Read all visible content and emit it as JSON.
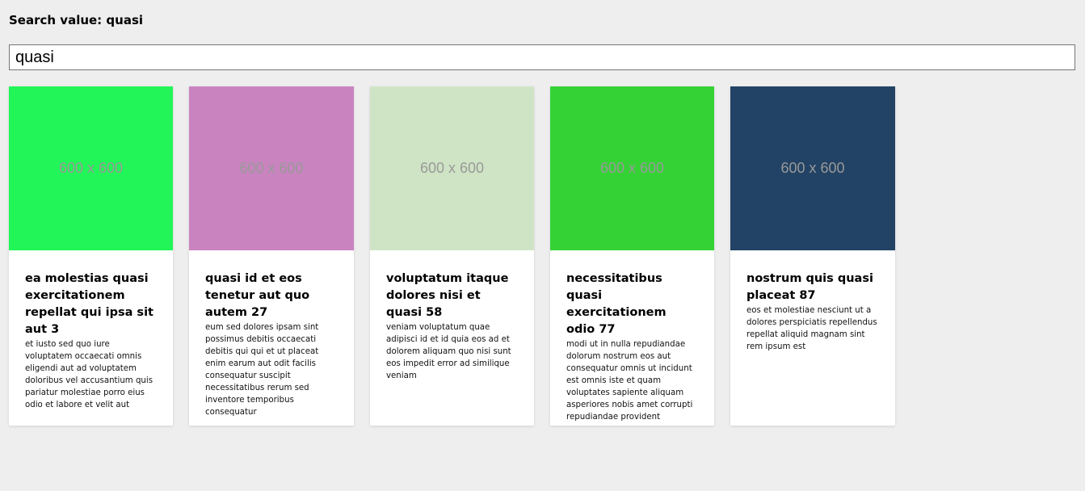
{
  "search": {
    "label": "Search value: quasi",
    "value": "quasi"
  },
  "cards": [
    {
      "color": "#22f557",
      "image_label": "600 x 600",
      "title": "ea molestias quasi exercitationem repellat qui ipsa sit aut 3",
      "text": "et iusto sed quo iure voluptatem occaecati omnis eligendi aut ad voluptatem doloribus vel accusantium quis pariatur molestiae porro eius odio et labore et velit aut"
    },
    {
      "color": "#c984c0",
      "image_label": "600 x 600",
      "title": "quasi id et eos tenetur aut quo autem 27",
      "text": "eum sed dolores ipsam sint possimus debitis occaecati debitis qui qui et ut placeat enim earum aut odit facilis consequatur suscipit necessitatibus rerum sed inventore temporibus consequatur"
    },
    {
      "color": "#cfe4c4",
      "image_label": "600 x 600",
      "title": "voluptatum itaque dolores nisi et quasi 58",
      "text": "veniam voluptatum quae adipisci id et id quia eos ad et dolorem aliquam quo nisi sunt eos impedit error ad similique veniam"
    },
    {
      "color": "#35d236",
      "image_label": "600 x 600",
      "title": "necessitatibus quasi exercitationem odio 77",
      "text": "modi ut in nulla repudiandae dolorum nostrum eos aut consequatur omnis ut incidunt est omnis iste et quam voluptates sapiente aliquam asperiores nobis amet corrupti repudiandae provident"
    },
    {
      "color": "#224365",
      "image_label": "600 x 600",
      "title": "nostrum quis quasi placeat 87",
      "text": "eos et molestiae nesciunt ut a dolores perspiciatis repellendus repellat aliquid magnam sint rem ipsum est"
    }
  ]
}
